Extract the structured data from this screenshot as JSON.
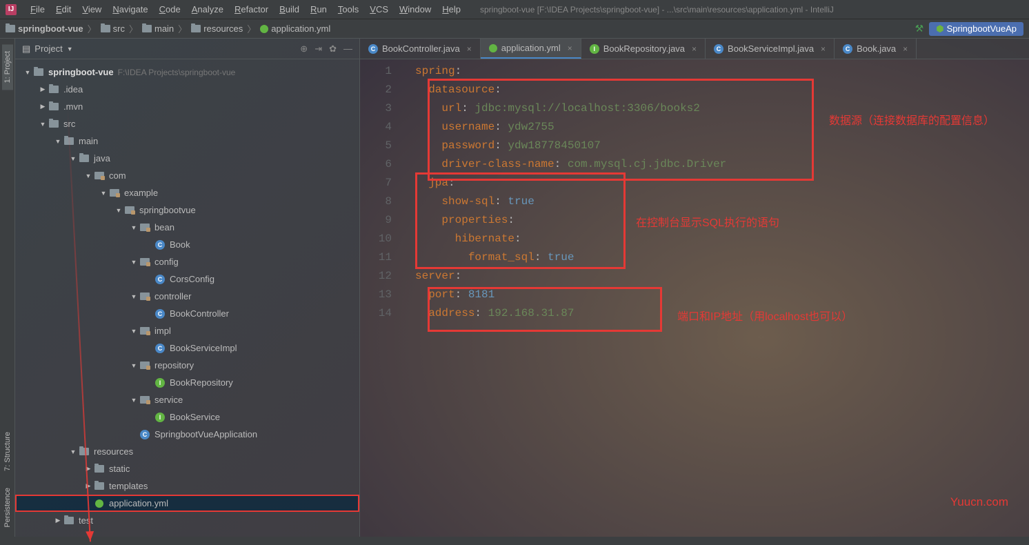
{
  "menu": {
    "items": [
      "File",
      "Edit",
      "View",
      "Navigate",
      "Code",
      "Analyze",
      "Refactor",
      "Build",
      "Run",
      "Tools",
      "VCS",
      "Window",
      "Help"
    ]
  },
  "title": "springboot-vue [F:\\IDEA Projects\\springboot-vue] - ...\\src\\main\\resources\\application.yml - IntelliJ",
  "breadcrumbs": [
    "springboot-vue",
    "src",
    "main",
    "resources",
    "application.yml"
  ],
  "run_config": "SpringbootVueAp",
  "sidebar": {
    "title": "Project",
    "gutter_tabs": [
      "1: Project",
      "7: Structure",
      "Persistence"
    ],
    "nodes": [
      {
        "d": 0,
        "e": 1,
        "i": "folder",
        "t": "springboot-vue",
        "b": 1,
        "h": "F:\\IDEA Projects\\springboot-vue"
      },
      {
        "d": 1,
        "e": 0,
        "i": "folder",
        "t": ".idea"
      },
      {
        "d": 1,
        "e": 0,
        "i": "folder",
        "t": ".mvn"
      },
      {
        "d": 1,
        "e": 1,
        "i": "folder",
        "t": "src"
      },
      {
        "d": 2,
        "e": 1,
        "i": "folder",
        "t": "main"
      },
      {
        "d": 3,
        "e": 1,
        "i": "folder",
        "t": "java"
      },
      {
        "d": 4,
        "e": 1,
        "i": "pkg",
        "t": "com"
      },
      {
        "d": 5,
        "e": 1,
        "i": "pkg",
        "t": "example"
      },
      {
        "d": 6,
        "e": 1,
        "i": "pkg",
        "t": "springbootvue"
      },
      {
        "d": 7,
        "e": 1,
        "i": "pkg",
        "t": "bean"
      },
      {
        "d": 8,
        "e": -1,
        "i": "cls-c",
        "t": "Book"
      },
      {
        "d": 7,
        "e": 1,
        "i": "pkg",
        "t": "config"
      },
      {
        "d": 8,
        "e": -1,
        "i": "cls-c",
        "t": "CorsConfig"
      },
      {
        "d": 7,
        "e": 1,
        "i": "pkg",
        "t": "controller"
      },
      {
        "d": 8,
        "e": -1,
        "i": "cls-c",
        "t": "BookController"
      },
      {
        "d": 7,
        "e": 1,
        "i": "pkg",
        "t": "impl"
      },
      {
        "d": 8,
        "e": -1,
        "i": "cls-c",
        "t": "BookServiceImpl"
      },
      {
        "d": 7,
        "e": 1,
        "i": "pkg",
        "t": "repository"
      },
      {
        "d": 8,
        "e": -1,
        "i": "cls-i",
        "t": "BookRepository"
      },
      {
        "d": 7,
        "e": 1,
        "i": "pkg",
        "t": "service"
      },
      {
        "d": 8,
        "e": -1,
        "i": "cls-i",
        "t": "BookService"
      },
      {
        "d": 7,
        "e": -1,
        "i": "cls-s",
        "t": "SpringbootVueApplication"
      },
      {
        "d": 3,
        "e": 1,
        "i": "folder",
        "t": "resources"
      },
      {
        "d": 4,
        "e": 0,
        "i": "folder",
        "t": "static"
      },
      {
        "d": 4,
        "e": 0,
        "i": "folder",
        "t": "templates"
      },
      {
        "d": 4,
        "e": -1,
        "i": "yml",
        "t": "application.yml",
        "sel": 1
      },
      {
        "d": 2,
        "e": 0,
        "i": "folder",
        "t": "test"
      }
    ]
  },
  "tabs": [
    {
      "i": "cls-c",
      "t": "BookController.java"
    },
    {
      "i": "yml",
      "t": "application.yml",
      "a": 1
    },
    {
      "i": "cls-i",
      "t": "BookRepository.java"
    },
    {
      "i": "cls-c",
      "t": "BookServiceImpl.java"
    },
    {
      "i": "cls-c",
      "t": "Book.java"
    }
  ],
  "code": {
    "lines": [
      [
        [
          "k",
          "spring"
        ],
        [
          "p",
          ":"
        ]
      ],
      [
        [
          "p",
          "  "
        ],
        [
          "k",
          "datasource"
        ],
        [
          "p",
          ":"
        ]
      ],
      [
        [
          "p",
          "    "
        ],
        [
          "k",
          "url"
        ],
        [
          "p",
          ": "
        ],
        [
          "s",
          "jdbc:mysql://localhost:3306/books2"
        ]
      ],
      [
        [
          "p",
          "    "
        ],
        [
          "k",
          "username"
        ],
        [
          "p",
          ": "
        ],
        [
          "s",
          "ydw2755"
        ]
      ],
      [
        [
          "p",
          "    "
        ],
        [
          "k",
          "password"
        ],
        [
          "p",
          ": "
        ],
        [
          "s",
          "ydw18778450107"
        ]
      ],
      [
        [
          "p",
          "    "
        ],
        [
          "k",
          "driver-class-name"
        ],
        [
          "p",
          ": "
        ],
        [
          "s",
          "com.mysql.cj.jdbc.Driver"
        ]
      ],
      [
        [
          "p",
          "  "
        ],
        [
          "k",
          "jpa"
        ],
        [
          "p",
          ":"
        ]
      ],
      [
        [
          "p",
          "    "
        ],
        [
          "k",
          "show-sql"
        ],
        [
          "p",
          ": "
        ],
        [
          "v",
          "true"
        ]
      ],
      [
        [
          "p",
          "    "
        ],
        [
          "k",
          "properties"
        ],
        [
          "p",
          ":"
        ]
      ],
      [
        [
          "p",
          "      "
        ],
        [
          "k",
          "hibernate"
        ],
        [
          "p",
          ":"
        ]
      ],
      [
        [
          "p",
          "        "
        ],
        [
          "k",
          "format_sql"
        ],
        [
          "p",
          ": "
        ],
        [
          "v",
          "true"
        ]
      ],
      [
        [
          "k",
          "server"
        ],
        [
          "p",
          ":"
        ]
      ],
      [
        [
          "p",
          "  "
        ],
        [
          "k",
          "port"
        ],
        [
          "p",
          ": "
        ],
        [
          "v",
          "8181"
        ]
      ],
      [
        [
          "p",
          "  "
        ],
        [
          "k",
          "address"
        ],
        [
          "p",
          ": "
        ],
        [
          "s",
          "192.168.31.87"
        ]
      ]
    ]
  },
  "annotations": {
    "a1": "数据源（连接数据库的配置信息）",
    "a2": "在控制台显示SQL执行的语句",
    "a3": "端口和IP地址（用localhost也可以）"
  },
  "watermark": "Yuucn.com"
}
